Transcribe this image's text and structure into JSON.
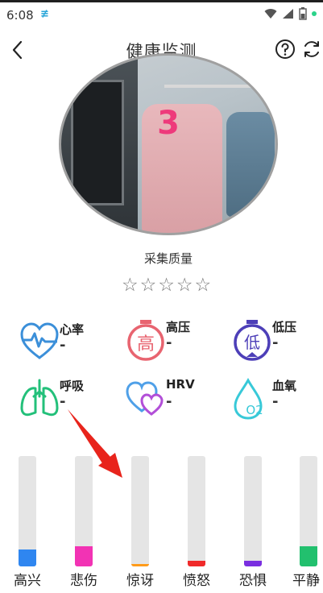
{
  "status_bar": {
    "time": "6:08",
    "app_icon": "≢"
  },
  "header": {
    "title": "健康监测"
  },
  "camera": {
    "countdown": "3"
  },
  "quality": {
    "label": "采集质量",
    "rating": 0,
    "max": 5
  },
  "metrics": [
    {
      "name": "心率",
      "value": "-",
      "icon": "heart-pulse-icon",
      "color": "#3b8fd9"
    },
    {
      "name": "高压",
      "value": "-",
      "icon": "high-pressure-icon",
      "color": "#e86470"
    },
    {
      "name": "低压",
      "value": "-",
      "icon": "low-pressure-icon",
      "color": "#4d3fb8"
    },
    {
      "name": "呼吸",
      "value": "-",
      "icon": "lungs-icon",
      "color": "#23c07a"
    },
    {
      "name": "HRV",
      "value": "-",
      "icon": "hrv-hearts-icon",
      "color": "#6a4fd8"
    },
    {
      "name": "血氧",
      "value": "-",
      "icon": "blood-oxygen-icon",
      "color": "#38c9d8"
    }
  ],
  "emotions": [
    {
      "label": "高兴",
      "level": 0.15,
      "color": "#2f86f0"
    },
    {
      "label": "悲伤",
      "level": 0.18,
      "color": "#f233b4"
    },
    {
      "label": "惊讶",
      "level": 0.02,
      "color": "#ff9b1a"
    },
    {
      "label": "愤怒",
      "level": 0.05,
      "color": "#f02a2a"
    },
    {
      "label": "恐惧",
      "level": 0.05,
      "color": "#7a2fe0"
    },
    {
      "label": "平静",
      "level": 0.18,
      "color": "#22c06e"
    }
  ]
}
